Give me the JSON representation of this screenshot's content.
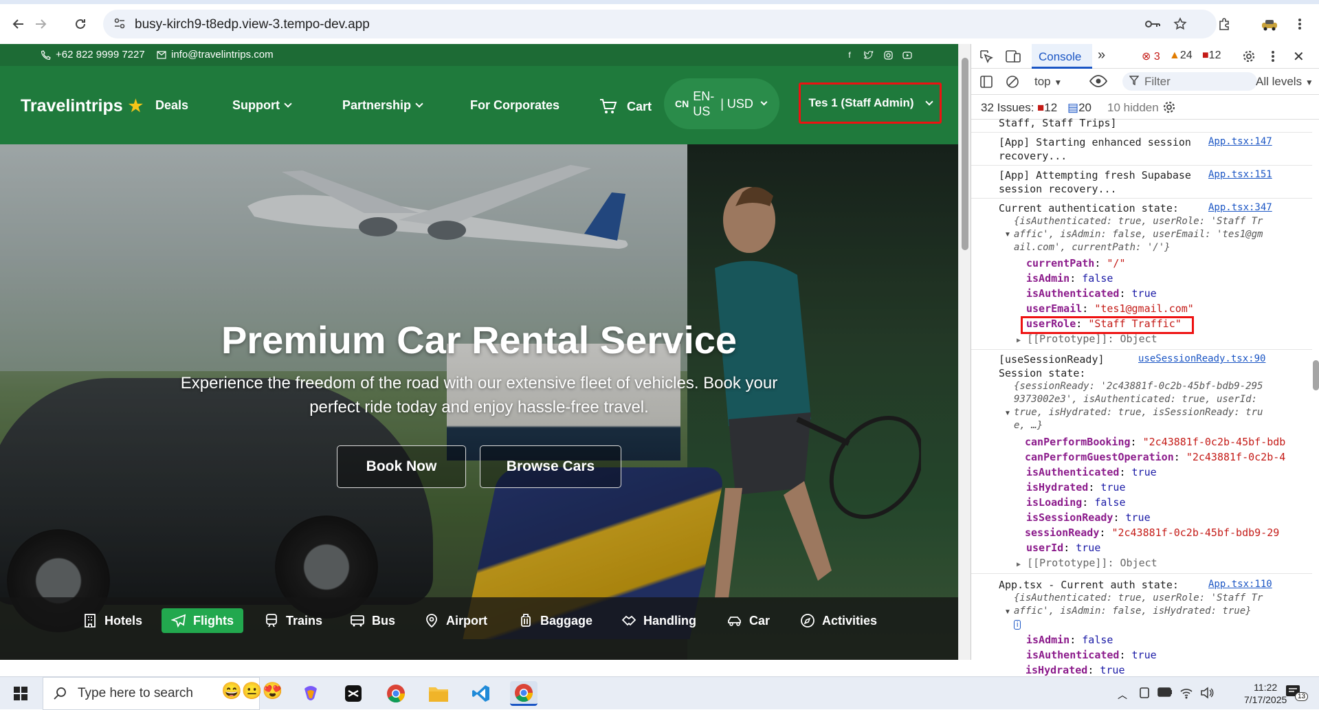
{
  "browser": {
    "url": "busy-kirch9-t8edp.view-3.tempo-dev.app"
  },
  "site": {
    "topbar": {
      "phone": "+62 822 9999 7227",
      "email": "info@travelintrips.com"
    },
    "logo": "Travelintrips",
    "nav": {
      "deals": "Deals",
      "support": "Support",
      "partnership": "Partnership",
      "corporates": "For Corporates",
      "cart": "Cart",
      "lang_code": "CN",
      "lang": "EN-US",
      "currency": "| USD",
      "user": "Tes 1 (Staff Admin)"
    },
    "hero": {
      "title": "Premium Car Rental Service",
      "subtitle": "Experience the freedom of the road with our extensive fleet of vehicles. Book your perfect ride today and enjoy hassle-free travel.",
      "book_now": "Book Now",
      "browse_cars": "Browse Cars"
    },
    "tabs": [
      {
        "label": "Hotels",
        "icon": "hotel-icon"
      },
      {
        "label": "Flights",
        "icon": "plane-icon",
        "active": true
      },
      {
        "label": "Trains",
        "icon": "train-icon"
      },
      {
        "label": "Bus",
        "icon": "bus-icon"
      },
      {
        "label": "Airport",
        "icon": "map-pin-icon"
      },
      {
        "label": "Baggage",
        "icon": "luggage-icon"
      },
      {
        "label": "Handling",
        "icon": "handshake-icon"
      },
      {
        "label": "Car",
        "icon": "car-icon"
      },
      {
        "label": "Activities",
        "icon": "compass-icon"
      }
    ]
  },
  "devtools": {
    "tab_console": "Console",
    "errors": "3",
    "warnings": "24",
    "info": "12",
    "context": "top",
    "filter_placeholder": "Filter",
    "levels": "All levels",
    "issues_label": "32 Issues:",
    "issues_err": "12",
    "issues_msg": "20",
    "hidden": "10 hidden",
    "logs": {
      "l0": "Staff, Staff Trips]",
      "l1a": "[App] Starting enhanced session",
      "l1b": "recovery...",
      "l1link": "App.tsx:147",
      "l2a": "[App] Attempting fresh Supabase",
      "l2b": "session recovery...",
      "l2link": "App.tsx:151",
      "l3a": "Current authentication state:",
      "l3link": "App.tsx:347",
      "l3s1": "{isAuthenticated: true, userRole: 'Staff Tr",
      "l3s2": "affic', isAdmin: false, userEmail: 'tes1@gm",
      "l3s3": "ail.com', currentPath: '/'}",
      "currentPath_k": "currentPath",
      "currentPath_v": "\"/\"",
      "isAdmin_k": "isAdmin",
      "isAdmin_v": "false",
      "isAuthenticated_k": "isAuthenticated",
      "isAuthenticated_v": "true",
      "userEmail_k": "userEmail",
      "userEmail_v": "\"tes1@gmail.com\"",
      "userRole_k": "userRole",
      "userRole_v": "\"Staff Traffic\"",
      "proto": "[[Prototype]]: Object",
      "l4a": "[useSessionReady]",
      "l4b": "Session state:",
      "l4link": "useSessionReady.tsx:90",
      "l4s1": "{sessionReady: '2c43881f-0c2b-45bf-bdb9-295",
      "l4s2": "9373002e3', isAuthenticated: true, userId:",
      "l4s3": "true, isHydrated: true, isSessionReady: tru",
      "l4s4": "e, …}",
      "cpb_k": "canPerformBooking",
      "cpb_v": "\"2c43881f-0c2b-45bf-bdb",
      "cpg_k": "canPerformGuestOperation",
      "cpg_v": "\"2c43881f-0c2b-4",
      "ia2_k": "isAuthenticated",
      "ia2_v": "true",
      "ih_k": "isHydrated",
      "ih_v": "true",
      "il_k": "isLoading",
      "il_v": "false",
      "isr_k": "isSessionReady",
      "isr_v": "true",
      "sr_k": "sessionReady",
      "sr_v": "\"2c43881f-0c2b-45bf-bdb9-29",
      "uid_k": "userId",
      "uid_v": "true",
      "l5a": "App.tsx - Current auth state:",
      "l5link": "App.tsx:110",
      "l5s1": "{isAuthenticated: true, userRole: 'Staff Tr",
      "l5s2": "affic', isAdmin: false, isHydrated: true}",
      "ia3_k": "isAdmin",
      "ia3_v": "false",
      "iau3_k": "isAuthenticated",
      "iau3_v": "true",
      "ih3_k": "isHydrated",
      "ih3_v": "true"
    }
  },
  "taskbar": {
    "search_placeholder": "Type here to search",
    "time": "11:22",
    "date": "7/17/2025",
    "notifications": "13"
  },
  "colors": {
    "brand_green": "#1f7a3c",
    "active_tab": "#22a84e",
    "highlight_red": "#e11111"
  }
}
